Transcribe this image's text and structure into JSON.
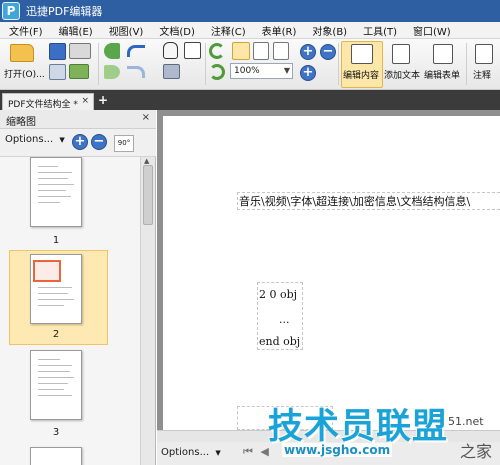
{
  "app": {
    "title": "迅捷PDF编辑器",
    "logo_letter": "P"
  },
  "menu": [
    "文件(F)",
    "编辑(E)",
    "视图(V)",
    "文档(D)",
    "注释(C)",
    "表单(R)",
    "对象(B)",
    "工具(T)",
    "窗口(W)"
  ],
  "toolbar": {
    "open_label": "打开(O)...",
    "zoom_value": "100%",
    "edit_content_label": "编辑内容",
    "add_text_label": "添加文本",
    "edit_form_label": "编辑表单",
    "annotate_label": "注释"
  },
  "tab": {
    "label": "PDF文件结构全 *",
    "close": "×",
    "add": "+"
  },
  "panel": {
    "title": "缩略图",
    "close": "×",
    "options_label": "Options...",
    "rotate_label": "90°",
    "thumbnails": [
      {
        "number": "1",
        "selected": false
      },
      {
        "number": "2",
        "selected": true
      },
      {
        "number": "3",
        "selected": false
      }
    ]
  },
  "document": {
    "line1": "音乐\\视频\\字体\\超连接\\加密信息\\文档结构信息\\",
    "obj_line": "2 0 obj",
    "ellipsis": "...",
    "endobj_line": "end obj"
  },
  "bottom": {
    "options_label": "Options..."
  },
  "watermark": {
    "main": "技术员联盟",
    "url": "www.jsgho.com",
    "side1": "51.net",
    "side2": "之家"
  },
  "colors": {
    "title_bar": "#2f5fa3",
    "tab_bar": "#3b3b3b",
    "selected_thumb": "#fde9b1",
    "watermark": "#1aa3d8"
  }
}
